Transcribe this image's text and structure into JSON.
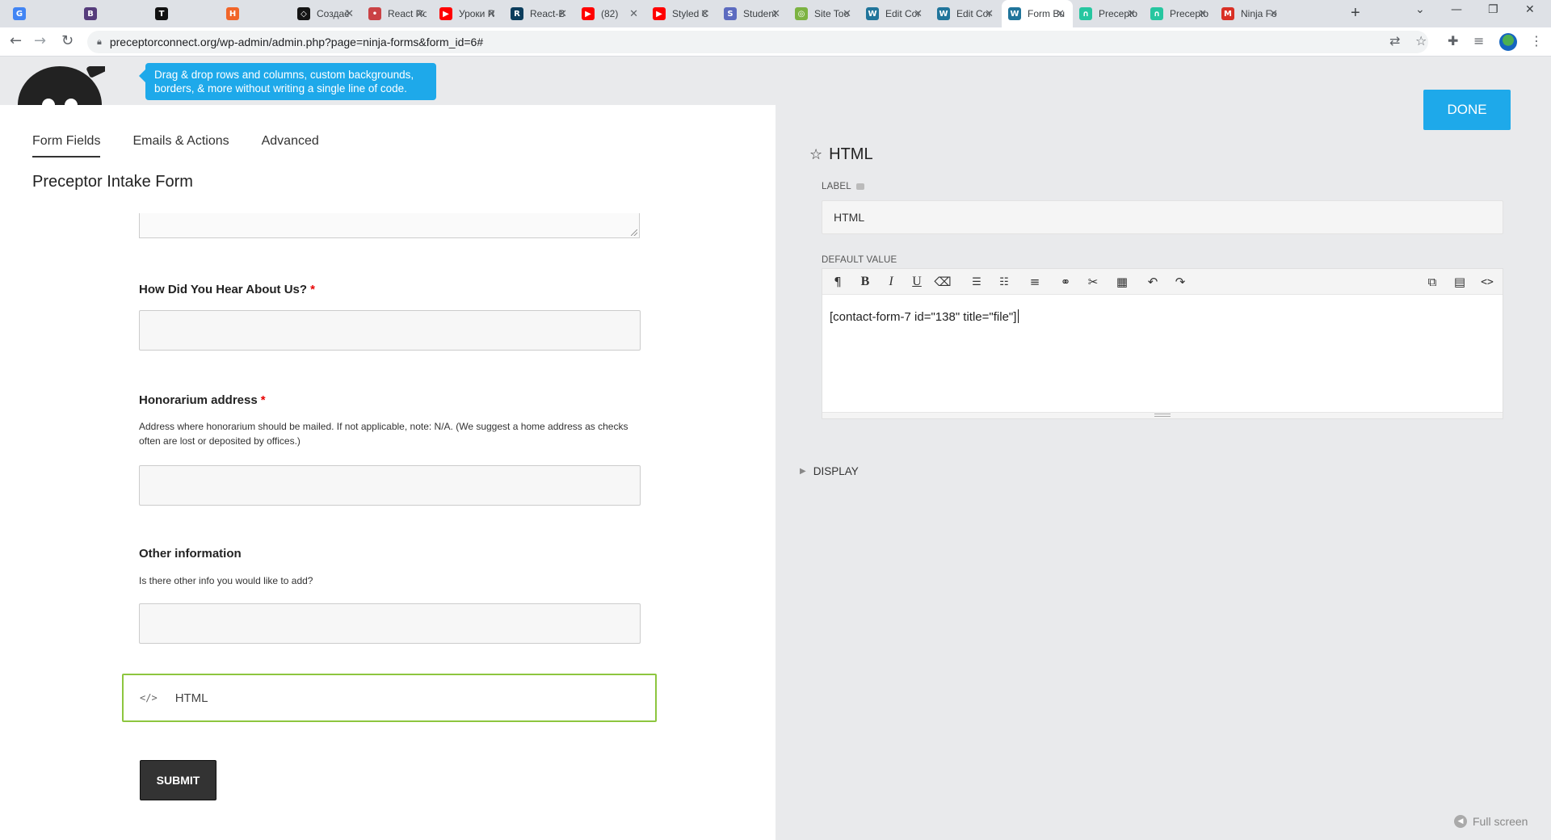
{
  "browser": {
    "tabs": [
      {
        "title": "",
        "favicon": "google-translate-icon",
        "color": "#4285f4",
        "glyph": "G"
      },
      {
        "title": "",
        "favicon": "bootstrap-icon",
        "color": "#563d7c",
        "glyph": "B"
      },
      {
        "title": "",
        "favicon": "tb-icon",
        "color": "#111111",
        "glyph": "T"
      },
      {
        "title": "",
        "favicon": "html-icon",
        "color": "#f16529",
        "glyph": "H"
      },
      {
        "title": "Создаё",
        "favicon": "codesandbox-icon",
        "color": "#151515",
        "glyph": "◇"
      },
      {
        "title": "React Ro",
        "favicon": "react-router-icon",
        "color": "#ca4245",
        "glyph": "•"
      },
      {
        "title": "Уроки R",
        "favicon": "youtube-icon",
        "color": "#ff0000",
        "glyph": "▶"
      },
      {
        "title": "React-B",
        "favicon": "react-bootstrap-icon",
        "color": "#0b3d5c",
        "glyph": "R"
      },
      {
        "title": "(82)",
        "favicon": "youtube-icon",
        "color": "#ff0000",
        "glyph": "▶"
      },
      {
        "title": "Styled C",
        "favicon": "youtube-icon",
        "color": "#ff0000",
        "glyph": "▶"
      },
      {
        "title": "Student",
        "favicon": "stack-icon",
        "color": "#5c6bc0",
        "glyph": "S"
      },
      {
        "title": "Site Too",
        "favicon": "site-tools-icon",
        "color": "#7cb342",
        "glyph": "◎"
      },
      {
        "title": "Edit Cor",
        "favicon": "wordpress-icon",
        "color": "#21759b",
        "glyph": "W"
      },
      {
        "title": "Edit Cor",
        "favicon": "wordpress-icon",
        "color": "#21759b",
        "glyph": "W"
      },
      {
        "title": "Form Bu",
        "favicon": "wordpress-icon",
        "color": "#21759b",
        "glyph": "W",
        "active": true
      },
      {
        "title": "Precepto",
        "favicon": "preceptor-icon",
        "color": "#26c6a0",
        "glyph": "∩"
      },
      {
        "title": "Precepto",
        "favicon": "preceptor-icon",
        "color": "#26c6a0",
        "glyph": "∩"
      },
      {
        "title": "Ninja Fo",
        "favicon": "gmail-icon",
        "color": "#d93025",
        "glyph": "M"
      }
    ],
    "url": "preceptorconnect.org/wp-admin/admin.php?page=ninja-forms&form_id=6#"
  },
  "banner": {
    "tooltip": "Drag & drop rows and columns, custom backgrounds, borders, & more without writing a single line of code."
  },
  "builder": {
    "tabs": [
      "Form Fields",
      "Emails & Actions",
      "Advanced"
    ],
    "form_title": "Preceptor Intake Form",
    "fields": [
      {
        "label": "How Did You Hear About Us?",
        "required": "*"
      },
      {
        "label": "Honorarium address",
        "required": "*",
        "description": "Address where honorarium should be mailed. If not applicable, note: N/A. (We suggest a home address as checks often are lost or deposited by offices.)"
      },
      {
        "label": "Other information",
        "description": "Is there other info you would like to add?"
      }
    ],
    "html_field_label": "HTML",
    "submit_label": "SUBMIT"
  },
  "drawer": {
    "done_label": "DONE",
    "title": "HTML",
    "label_heading": "LABEL",
    "label_value": "HTML",
    "default_value_heading": "DEFAULT VALUE",
    "editor_content": "[contact-form-7 id=\"138\" title=\"file\"]",
    "display_heading": "DISPLAY",
    "fullscreen_label": "Full screen"
  },
  "colors": {
    "accent": "#1ea9ea",
    "active_field_border": "#8dc63f",
    "required": "#e80000",
    "submit_bg": "#333333"
  }
}
